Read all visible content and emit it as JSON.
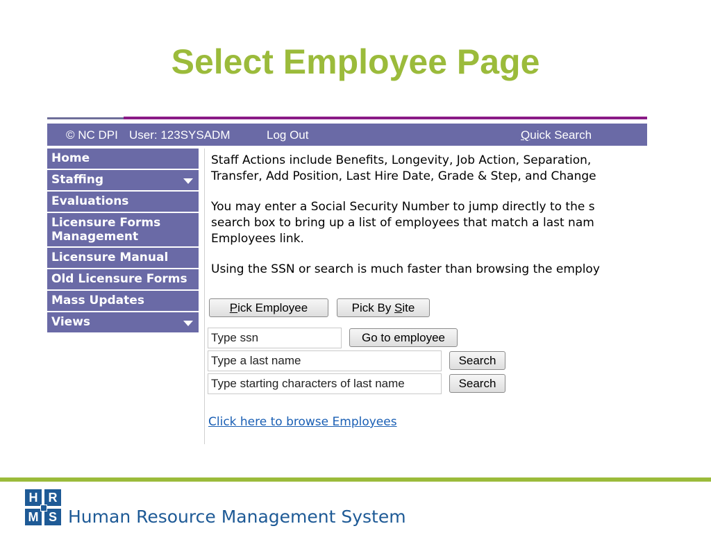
{
  "slide": {
    "title": "Select Employee Page"
  },
  "topbar": {
    "copyright": "© NC DPI",
    "user": "User: 123SYSADM",
    "logout": "Log Out",
    "quick_search_first": "Q",
    "quick_search_rest": "uick Search"
  },
  "sidebar": {
    "items": [
      {
        "label": "Home",
        "has_dropdown": false
      },
      {
        "label": "Staffing",
        "has_dropdown": true
      },
      {
        "label": "Evaluations",
        "has_dropdown": false
      },
      {
        "label": "Licensure Forms Management",
        "has_dropdown": false
      },
      {
        "label": "Licensure Manual",
        "has_dropdown": false
      },
      {
        "label": "Old Licensure Forms",
        "has_dropdown": false
      },
      {
        "label": "Mass Updates",
        "has_dropdown": false
      },
      {
        "label": "Views",
        "has_dropdown": true
      }
    ]
  },
  "content": {
    "para1_line1": "Staff Actions include Benefits, Longevity, Job Action, Separation,",
    "para1_line2": "Transfer, Add Position, Last Hire Date, Grade & Step, and Change",
    "para2_line1": "You may enter a Social Security Number to jump directly to the s",
    "para2_line2": "search box to bring up a list of employees that match a last nam",
    "para2_line3": "Employees link.",
    "para3": "Using the SSN or search is much faster than browsing the employ",
    "pick_employee_key": "P",
    "pick_employee_rest": "ick Employee",
    "pick_by_site_pre": "Pick By ",
    "pick_by_site_key": "S",
    "pick_by_site_rest": "ite",
    "ssn_placeholder": "Type ssn",
    "go_to_employee": "Go to employee",
    "lastname_placeholder": "Type a last name",
    "search_label_1": "Search",
    "starting_chars_placeholder": "Type starting characters of last name",
    "search_label_2": "Search",
    "browse_link": "Click here to browse Employees"
  },
  "footer": {
    "logo_letters": [
      "H",
      "R",
      "M",
      "S"
    ],
    "system_name": "Human Resource Management System"
  },
  "colors": {
    "title_green": "#9bbb3b",
    "nav_purple": "#6a6aa6",
    "accent_purple": "#8a1a86",
    "link_blue": "#1a5fb4",
    "logo_blue": "#1e5a96"
  }
}
